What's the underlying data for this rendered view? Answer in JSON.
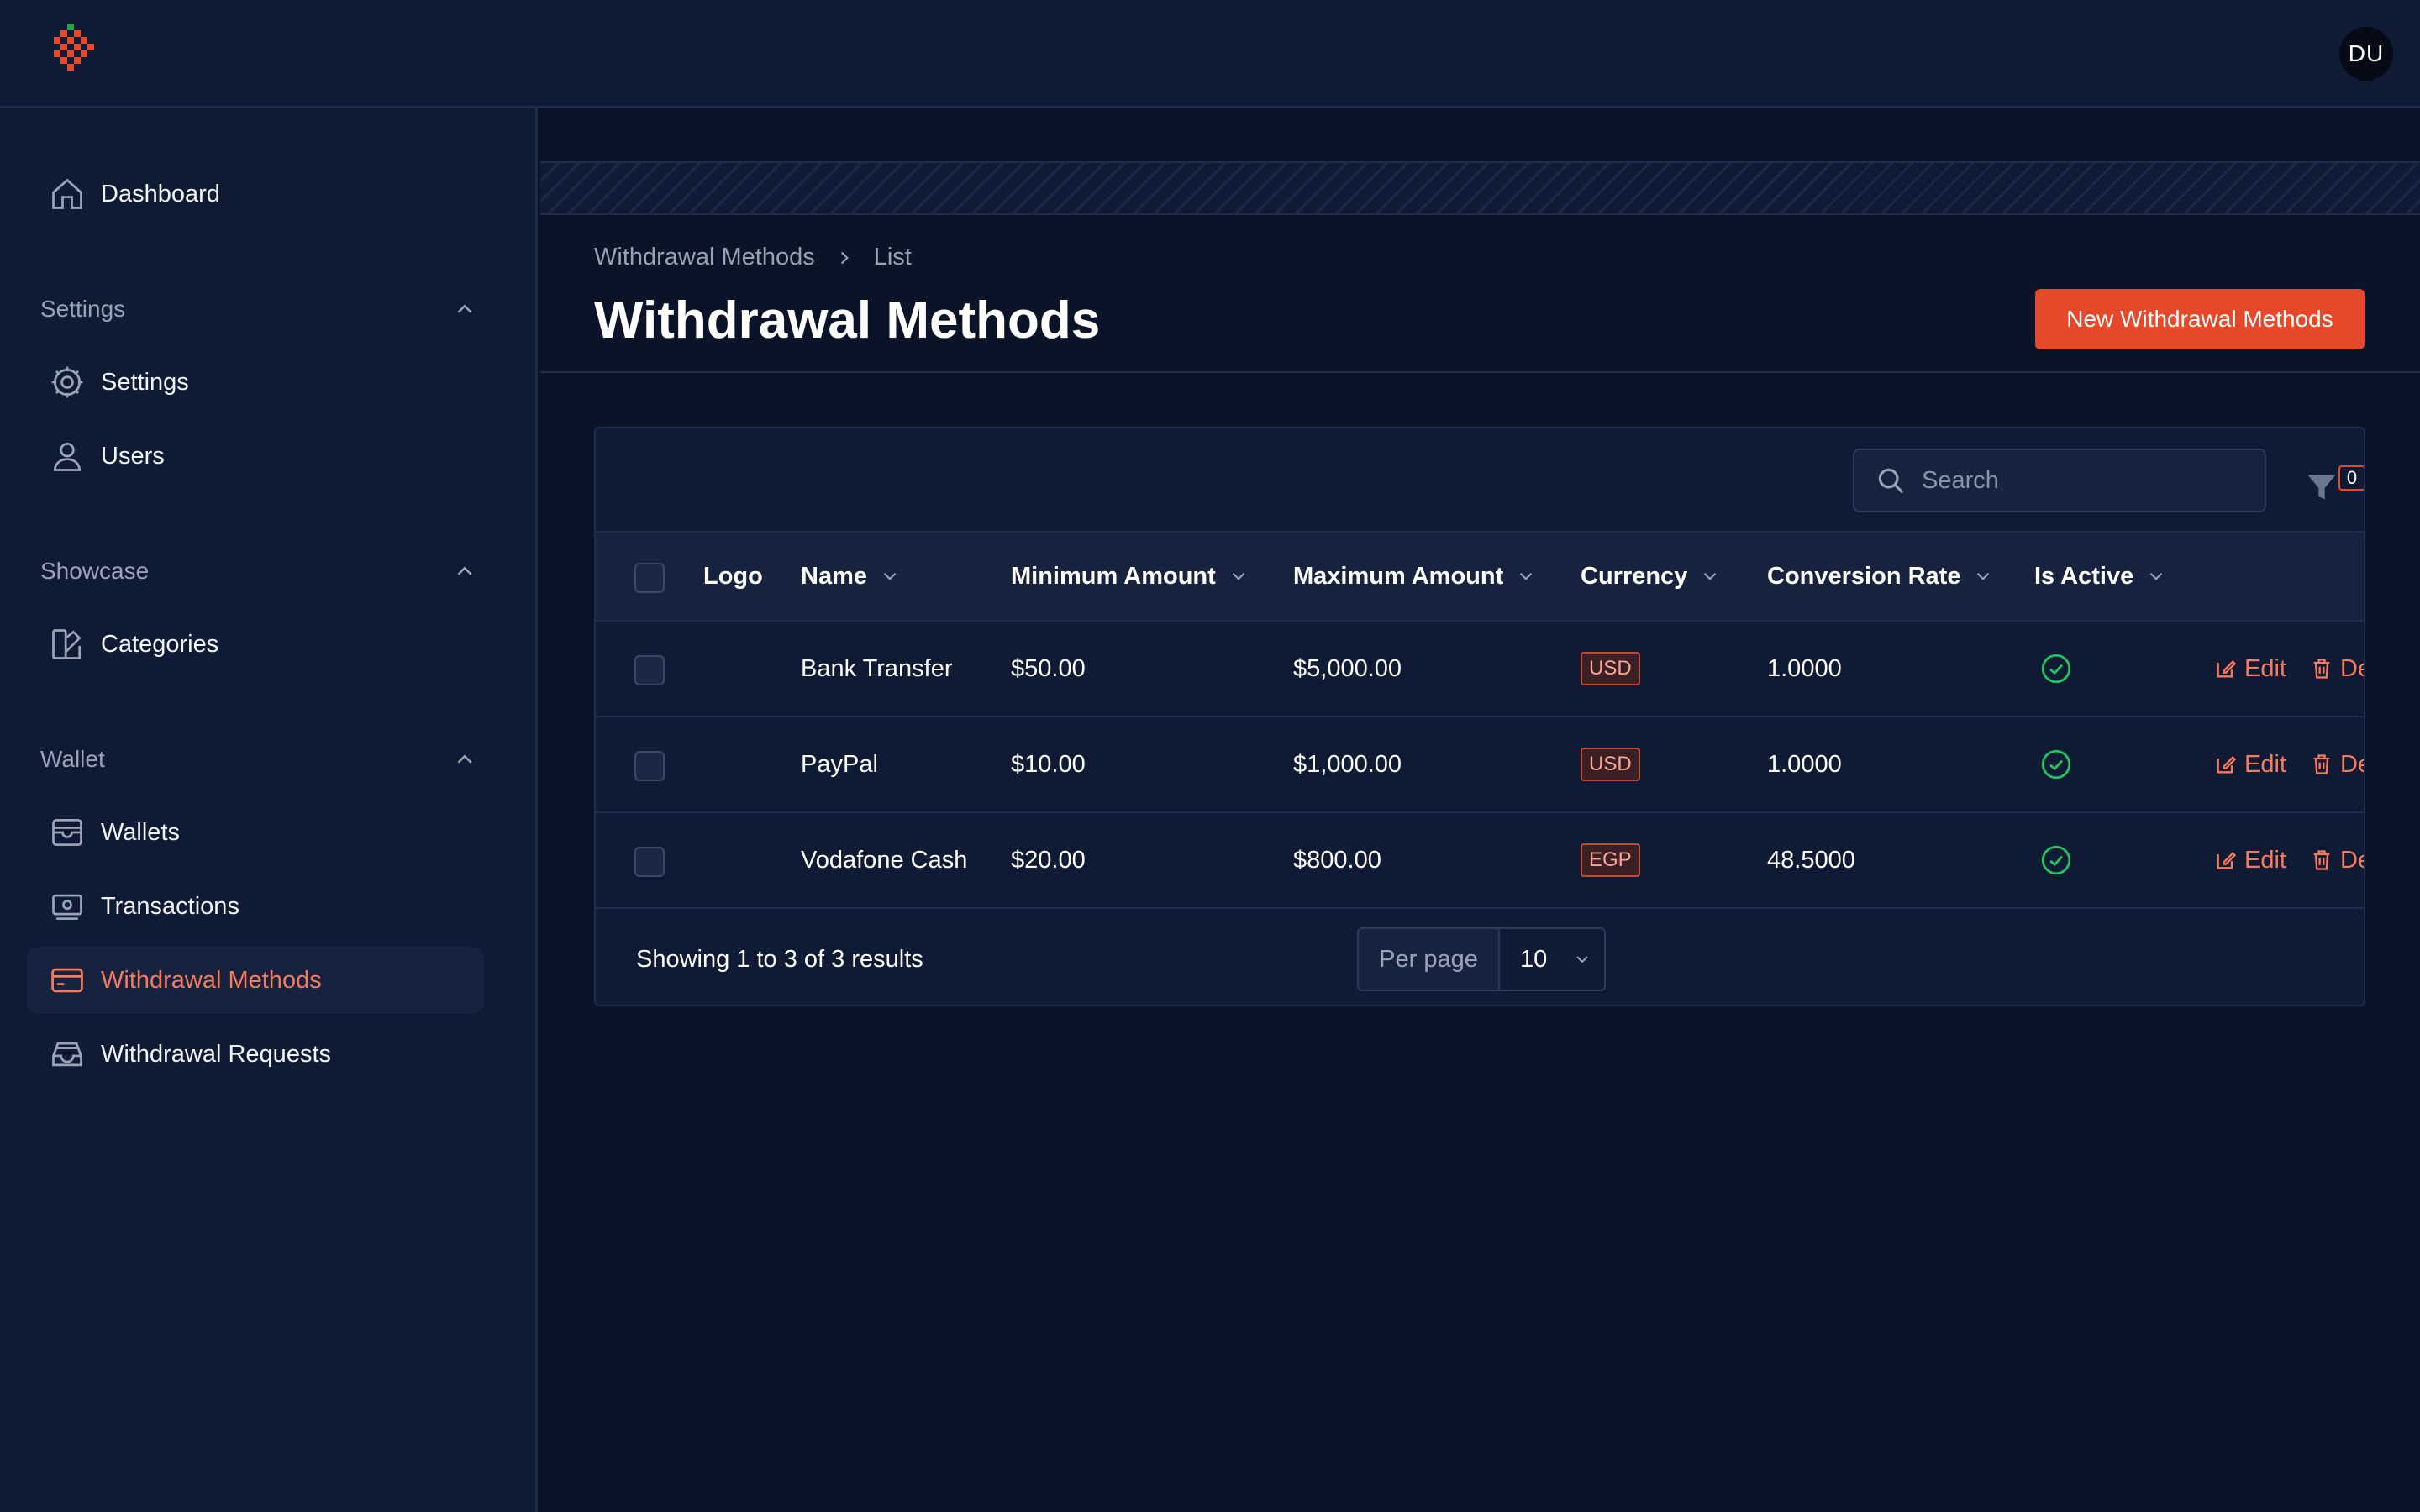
{
  "topbar": {
    "avatar_initials": "DU"
  },
  "sidebar": {
    "dashboard": "Dashboard",
    "groups": [
      {
        "label": "Settings",
        "items": [
          {
            "label": "Settings",
            "icon": "gear-icon"
          },
          {
            "label": "Users",
            "icon": "user-icon"
          }
        ]
      },
      {
        "label": "Showcase",
        "items": [
          {
            "label": "Categories",
            "icon": "categories-icon"
          }
        ]
      },
      {
        "label": "Wallet",
        "items": [
          {
            "label": "Wallets",
            "icon": "wallet-icon"
          },
          {
            "label": "Transactions",
            "icon": "banknote-icon"
          },
          {
            "label": "Withdrawal Methods",
            "icon": "credit-card-icon",
            "active": true
          },
          {
            "label": "Withdrawal Requests",
            "icon": "inbox-icon"
          }
        ]
      }
    ]
  },
  "breadcrumb": {
    "parent": "Withdrawal Methods",
    "current": "List"
  },
  "page_title": "Withdrawal Methods",
  "new_button": "New Withdrawal Methods",
  "search": {
    "placeholder": "Search"
  },
  "filter": {
    "count": "0"
  },
  "table": {
    "columns": {
      "logo": "Logo",
      "name": "Name",
      "min": "Minimum Amount",
      "max": "Maximum Amount",
      "currency": "Currency",
      "rate": "Conversion Rate",
      "active": "Is Active"
    },
    "rows": [
      {
        "name": "Bank Transfer",
        "min": "$50.00",
        "max": "$5,000.00",
        "currency": "USD",
        "rate": "1.0000",
        "active": true,
        "edit": "Edit",
        "delete": "De"
      },
      {
        "name": "PayPal",
        "min": "$10.00",
        "max": "$1,000.00",
        "currency": "USD",
        "rate": "1.0000",
        "active": true,
        "edit": "Edit",
        "delete": "De"
      },
      {
        "name": "Vodafone Cash",
        "min": "$20.00",
        "max": "$800.00",
        "currency": "EGP",
        "rate": "48.5000",
        "active": true,
        "edit": "Edit",
        "delete": "De"
      }
    ]
  },
  "footer": {
    "results": "Showing 1 to 3 of 3 results",
    "per_page_label": "Per page",
    "per_page_value": "10"
  },
  "colors": {
    "accent": "#e5492a",
    "active_text": "#f87a5c",
    "success": "#22c55e",
    "bg": "#0b1328",
    "panel": "#0f1a35"
  }
}
